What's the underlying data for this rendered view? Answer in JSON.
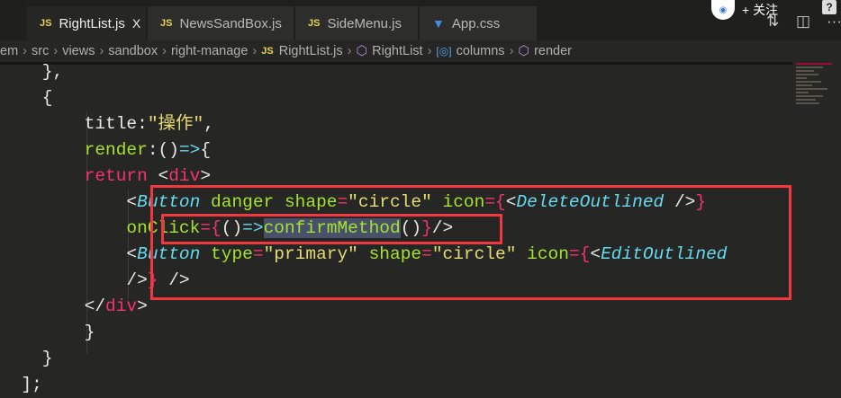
{
  "tabs": [
    {
      "label": "RightList.js",
      "icon": "js-icon",
      "active": true,
      "close": "X"
    },
    {
      "label": "NewsSandBox.js",
      "icon": "js-icon"
    },
    {
      "label": "SideMenu.js",
      "icon": "js-icon"
    },
    {
      "label": "App.css",
      "icon": "css-icon"
    }
  ],
  "overlay": {
    "follow_label": "+ 关注",
    "help": "?"
  },
  "actions": {
    "compare": "⇅",
    "split": "◫",
    "more": "···"
  },
  "breadcrumb": [
    "em",
    "src",
    "views",
    "sandbox",
    "right-manage",
    "RightList.js",
    "RightList",
    "columns",
    "render"
  ],
  "code_lines": [
    [
      [
        "    },",
        "p"
      ]
    ],
    [
      [
        "    {",
        "p"
      ]
    ],
    [
      [
        "        title",
        "p"
      ],
      [
        ":",
        "p"
      ],
      [
        "\"操作\"",
        "s"
      ],
      [
        ",",
        "p"
      ]
    ],
    [
      [
        "        render",
        "f"
      ],
      [
        ":",
        "p"
      ],
      [
        "()",
        "p"
      ],
      [
        "=>",
        "ar"
      ],
      [
        "{",
        "p"
      ]
    ],
    [
      [
        "        return",
        "k"
      ],
      [
        " <",
        "p"
      ],
      [
        "div",
        "k"
      ],
      [
        ">",
        "p"
      ]
    ],
    [
      [
        "            <",
        "p"
      ],
      [
        "Button",
        "c"
      ],
      [
        " danger shape",
        "a"
      ],
      [
        "=",
        "o"
      ],
      [
        "\"circle\"",
        "s"
      ],
      [
        " icon",
        "a"
      ],
      [
        "={",
        "o"
      ],
      [
        "<",
        "p"
      ],
      [
        "DeleteOutlined",
        "c"
      ],
      [
        " />",
        "p"
      ],
      [
        "}",
        "o"
      ]
    ],
    [
      [
        "            onClick",
        "a"
      ],
      [
        "={",
        "o"
      ],
      [
        "()",
        "p"
      ],
      [
        "=>",
        "ar"
      ],
      [
        "confirmMethod",
        "f sel"
      ],
      [
        "()",
        "p"
      ],
      [
        "}",
        "o"
      ],
      [
        "/>",
        "p"
      ]
    ],
    [
      [
        "            <",
        "p"
      ],
      [
        "Button",
        "c"
      ],
      [
        " type",
        "a"
      ],
      [
        "=",
        "o"
      ],
      [
        "\"primary\"",
        "s"
      ],
      [
        " shape",
        "a"
      ],
      [
        "=",
        "o"
      ],
      [
        "\"circle\"",
        "s"
      ],
      [
        " icon",
        "a"
      ],
      [
        "={",
        "o"
      ],
      [
        "<",
        "p"
      ],
      [
        "EditOutlined",
        "c"
      ]
    ],
    [
      [
        "            />",
        "p"
      ],
      [
        "}",
        "o"
      ],
      [
        " />",
        "p"
      ]
    ],
    [
      [
        "        </",
        "p"
      ],
      [
        "div",
        "k"
      ],
      [
        ">",
        "p"
      ]
    ],
    [
      [
        "        }",
        "p"
      ]
    ],
    [
      [
        "    }",
        "p"
      ]
    ],
    [
      [
        "  ];",
        "p"
      ]
    ]
  ]
}
